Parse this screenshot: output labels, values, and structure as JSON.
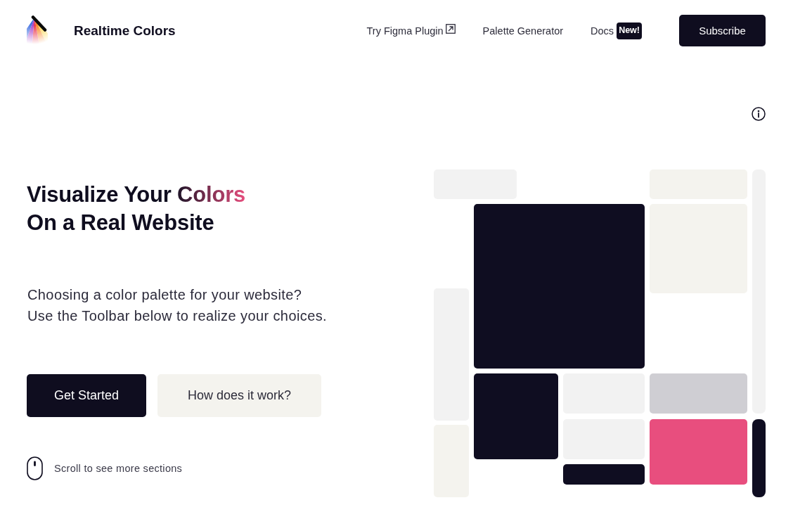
{
  "header": {
    "brand": "Realtime Colors",
    "nav": [
      {
        "label": "Try Figma Plugin",
        "kind": "external"
      },
      {
        "label": "Palette Generator",
        "kind": "plain"
      },
      {
        "label": "Docs",
        "kind": "badged",
        "badge": "New!"
      }
    ],
    "cta": "Subscribe"
  },
  "hero": {
    "headline": {
      "lines": [
        {
          "segments": [
            {
              "text": "Visualize Your ",
              "highlight": false
            },
            {
              "text": "Colors",
              "highlight": true
            }
          ]
        },
        {
          "segments": [
            {
              "text": "On a Real Website",
              "highlight": false
            }
          ]
        }
      ]
    },
    "description": [
      "Choosing a color palette for your website?",
      "Use the Toolbar below to realize your choices."
    ],
    "buttons": [
      {
        "label": "Get Started",
        "kind": "primary"
      },
      {
        "label": "How does it work?",
        "kind": "secondary"
      }
    ],
    "scroll_hint": "Scroll to see more sections"
  },
  "mosaic": {
    "tiles": [
      {
        "color": "#f2f2f2"
      },
      {
        "color": "#f4f3ee"
      },
      {
        "color": "#f2f2f2"
      },
      {
        "color": "#0f0d21"
      },
      {
        "color": "#f4f3ee"
      },
      {
        "color": "#f2f2f2"
      },
      {
        "color": "#0f0d21"
      },
      {
        "color": "#f2f2f2"
      },
      {
        "color": "#cfced3"
      },
      {
        "color": "#f2f2f2"
      },
      {
        "color": "#e84e7e"
      },
      {
        "color": "#0f0d21"
      },
      {
        "color": "#f4f3ee"
      },
      {
        "color": "#0f0d21"
      }
    ]
  }
}
